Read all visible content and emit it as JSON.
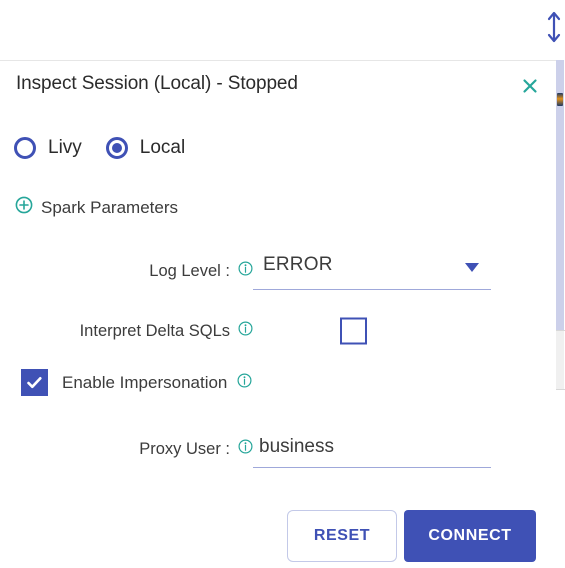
{
  "accents": {
    "indigo": "#3f51b5",
    "teal": "#26a69a",
    "underline": "#9fa8da",
    "text": "#3c3c3c"
  },
  "window": {
    "resize_handle_icon": "resize-vertical-icon"
  },
  "panel": {
    "title": "Inspect Session (Local) - Stopped",
    "close_icon": "close-icon"
  },
  "session_mode": {
    "options": [
      {
        "label": "Livy",
        "selected": false
      },
      {
        "label": "Local",
        "selected": true
      }
    ]
  },
  "spark_parameters": {
    "label": "Spark Parameters",
    "expand_icon": "plus-circle-icon",
    "expanded": false
  },
  "fields": {
    "log_level": {
      "label": "Log Level :",
      "info_icon": "info-circle-icon",
      "value": "ERROR",
      "dropdown_icon": "chevron-down-icon",
      "options": [
        "ERROR"
      ]
    },
    "interpret_delta_sqls": {
      "label": "Interpret Delta SQLs",
      "info_icon": "info-circle-icon",
      "checked": false
    },
    "enable_impersonation": {
      "label": "Enable Impersonation",
      "info_icon": "info-circle-icon",
      "checked": true,
      "check_icon": "checkmark-icon"
    },
    "proxy_user": {
      "label": "Proxy User :",
      "info_icon": "info-circle-icon",
      "value": "business",
      "placeholder": ""
    }
  },
  "actions": {
    "reset_label": "RESET",
    "connect_label": "CONNECT"
  }
}
